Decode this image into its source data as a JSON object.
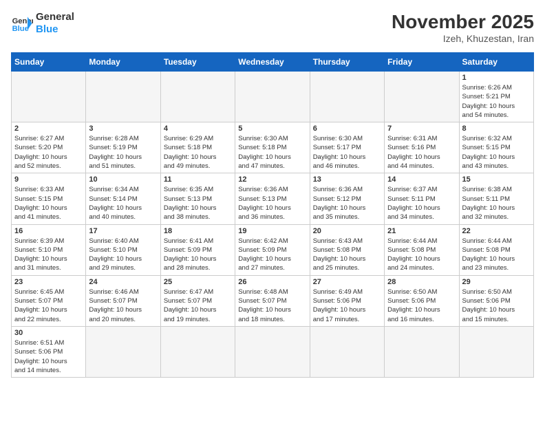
{
  "header": {
    "logo_general": "General",
    "logo_blue": "Blue",
    "title": "November 2025",
    "location": "Izeh, Khuzestan, Iran"
  },
  "days_of_week": [
    "Sunday",
    "Monday",
    "Tuesday",
    "Wednesday",
    "Thursday",
    "Friday",
    "Saturday"
  ],
  "weeks": [
    [
      {
        "day": "",
        "info": ""
      },
      {
        "day": "",
        "info": ""
      },
      {
        "day": "",
        "info": ""
      },
      {
        "day": "",
        "info": ""
      },
      {
        "day": "",
        "info": ""
      },
      {
        "day": "",
        "info": ""
      },
      {
        "day": "1",
        "info": "Sunrise: 6:26 AM\nSunset: 5:21 PM\nDaylight: 10 hours\nand 54 minutes."
      }
    ],
    [
      {
        "day": "2",
        "info": "Sunrise: 6:27 AM\nSunset: 5:20 PM\nDaylight: 10 hours\nand 52 minutes."
      },
      {
        "day": "3",
        "info": "Sunrise: 6:28 AM\nSunset: 5:19 PM\nDaylight: 10 hours\nand 51 minutes."
      },
      {
        "day": "4",
        "info": "Sunrise: 6:29 AM\nSunset: 5:18 PM\nDaylight: 10 hours\nand 49 minutes."
      },
      {
        "day": "5",
        "info": "Sunrise: 6:30 AM\nSunset: 5:18 PM\nDaylight: 10 hours\nand 47 minutes."
      },
      {
        "day": "6",
        "info": "Sunrise: 6:30 AM\nSunset: 5:17 PM\nDaylight: 10 hours\nand 46 minutes."
      },
      {
        "day": "7",
        "info": "Sunrise: 6:31 AM\nSunset: 5:16 PM\nDaylight: 10 hours\nand 44 minutes."
      },
      {
        "day": "8",
        "info": "Sunrise: 6:32 AM\nSunset: 5:15 PM\nDaylight: 10 hours\nand 43 minutes."
      }
    ],
    [
      {
        "day": "9",
        "info": "Sunrise: 6:33 AM\nSunset: 5:15 PM\nDaylight: 10 hours\nand 41 minutes."
      },
      {
        "day": "10",
        "info": "Sunrise: 6:34 AM\nSunset: 5:14 PM\nDaylight: 10 hours\nand 40 minutes."
      },
      {
        "day": "11",
        "info": "Sunrise: 6:35 AM\nSunset: 5:13 PM\nDaylight: 10 hours\nand 38 minutes."
      },
      {
        "day": "12",
        "info": "Sunrise: 6:36 AM\nSunset: 5:13 PM\nDaylight: 10 hours\nand 36 minutes."
      },
      {
        "day": "13",
        "info": "Sunrise: 6:36 AM\nSunset: 5:12 PM\nDaylight: 10 hours\nand 35 minutes."
      },
      {
        "day": "14",
        "info": "Sunrise: 6:37 AM\nSunset: 5:11 PM\nDaylight: 10 hours\nand 34 minutes."
      },
      {
        "day": "15",
        "info": "Sunrise: 6:38 AM\nSunset: 5:11 PM\nDaylight: 10 hours\nand 32 minutes."
      }
    ],
    [
      {
        "day": "16",
        "info": "Sunrise: 6:39 AM\nSunset: 5:10 PM\nDaylight: 10 hours\nand 31 minutes."
      },
      {
        "day": "17",
        "info": "Sunrise: 6:40 AM\nSunset: 5:10 PM\nDaylight: 10 hours\nand 29 minutes."
      },
      {
        "day": "18",
        "info": "Sunrise: 6:41 AM\nSunset: 5:09 PM\nDaylight: 10 hours\nand 28 minutes."
      },
      {
        "day": "19",
        "info": "Sunrise: 6:42 AM\nSunset: 5:09 PM\nDaylight: 10 hours\nand 27 minutes."
      },
      {
        "day": "20",
        "info": "Sunrise: 6:43 AM\nSunset: 5:08 PM\nDaylight: 10 hours\nand 25 minutes."
      },
      {
        "day": "21",
        "info": "Sunrise: 6:44 AM\nSunset: 5:08 PM\nDaylight: 10 hours\nand 24 minutes."
      },
      {
        "day": "22",
        "info": "Sunrise: 6:44 AM\nSunset: 5:08 PM\nDaylight: 10 hours\nand 23 minutes."
      }
    ],
    [
      {
        "day": "23",
        "info": "Sunrise: 6:45 AM\nSunset: 5:07 PM\nDaylight: 10 hours\nand 22 minutes."
      },
      {
        "day": "24",
        "info": "Sunrise: 6:46 AM\nSunset: 5:07 PM\nDaylight: 10 hours\nand 20 minutes."
      },
      {
        "day": "25",
        "info": "Sunrise: 6:47 AM\nSunset: 5:07 PM\nDaylight: 10 hours\nand 19 minutes."
      },
      {
        "day": "26",
        "info": "Sunrise: 6:48 AM\nSunset: 5:07 PM\nDaylight: 10 hours\nand 18 minutes."
      },
      {
        "day": "27",
        "info": "Sunrise: 6:49 AM\nSunset: 5:06 PM\nDaylight: 10 hours\nand 17 minutes."
      },
      {
        "day": "28",
        "info": "Sunrise: 6:50 AM\nSunset: 5:06 PM\nDaylight: 10 hours\nand 16 minutes."
      },
      {
        "day": "29",
        "info": "Sunrise: 6:50 AM\nSunset: 5:06 PM\nDaylight: 10 hours\nand 15 minutes."
      }
    ],
    [
      {
        "day": "30",
        "info": "Sunrise: 6:51 AM\nSunset: 5:06 PM\nDaylight: 10 hours\nand 14 minutes."
      },
      {
        "day": "",
        "info": ""
      },
      {
        "day": "",
        "info": ""
      },
      {
        "day": "",
        "info": ""
      },
      {
        "day": "",
        "info": ""
      },
      {
        "day": "",
        "info": ""
      },
      {
        "day": "",
        "info": ""
      }
    ]
  ]
}
